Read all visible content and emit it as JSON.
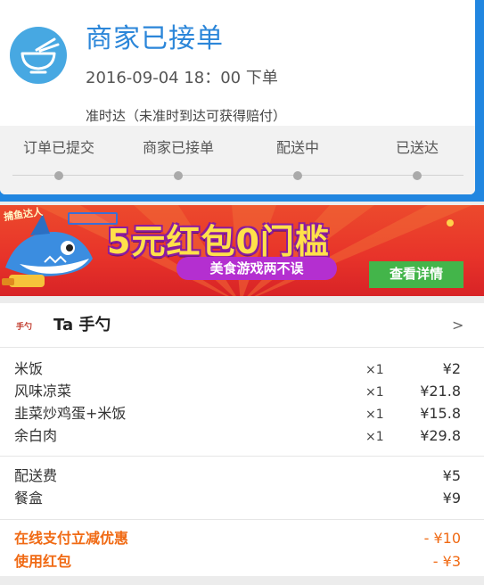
{
  "status": {
    "title": "商家已接单",
    "time": "2016-09-04 18：00 下单",
    "note": "准时达（未准时到达可获得赔付）",
    "icon": "bowl-chopsticks-icon",
    "accent_color": "#2b86d9"
  },
  "progress": {
    "steps": [
      {
        "label": "订单已提交"
      },
      {
        "label": "商家已接单"
      },
      {
        "label": "配送中"
      },
      {
        "label": "已送达"
      }
    ]
  },
  "banner": {
    "logo_text": "捕鱼达人",
    "headline": "5元红包0门槛",
    "subtitle": "美食游戏两不误",
    "button_label": "查看详情"
  },
  "order": {
    "shop_logo_text": "手勺",
    "shop_name": "Ta 手勺",
    "chevron": ">",
    "items": [
      {
        "name": "米饭",
        "qty": "×1",
        "price": "¥2"
      },
      {
        "name": "风味凉菜",
        "qty": "×1",
        "price": "¥21.8"
      },
      {
        "name": "韭菜炒鸡蛋+米饭",
        "qty": "×1",
        "price": "¥15.8"
      },
      {
        "name": "余白肉",
        "qty": "×1",
        "price": "¥29.8"
      }
    ],
    "fees": [
      {
        "name": "配送费",
        "price": "¥5"
      },
      {
        "name": "餐盒",
        "price": "¥9"
      }
    ],
    "discounts": [
      {
        "name": "在线支付立减优惠",
        "price": "- ¥10"
      },
      {
        "name": "使用红包",
        "price": "- ¥3"
      }
    ],
    "discount_color": "#f06a14"
  }
}
